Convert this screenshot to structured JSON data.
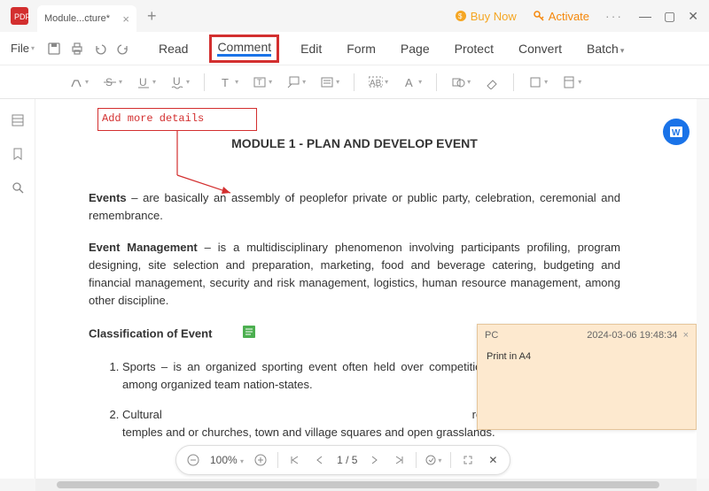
{
  "title": {
    "tab": "Module...cture*"
  },
  "titlebar": {
    "buynow": "Buy Now",
    "activate": "Activate"
  },
  "menu": {
    "file": "File",
    "tabs": [
      "Read",
      "Comment",
      "Edit",
      "Form",
      "Page",
      "Protect",
      "Convert",
      "Batch"
    ]
  },
  "annotation": {
    "text": "Add more details"
  },
  "doc": {
    "title": "MODULE 1 - PLAN AND DEVELOP EVENT",
    "p1a": "Events",
    "p1b": " – are basically an assembly of peoplefor private or public party, celebration, ceremonial and remembrance.",
    "p2a": "Event Management",
    "p2b": " – is a multidisciplinary phenomenon involving participants profiling, program designing, site selection and preparation, marketing, food and beverage catering, budgeting and financial management, security and risk management, logistics, human resource management, among other discipline.",
    "h2": "Classification of Event",
    "li1": "Sports – is an organized sporting event often held over competition in many different sports among organized team nation-states.",
    "li2_part": "Cultural",
    "li2_mid": "                                                                                             religion, local tradition",
    "li2_end": "e sites, temples and or churches, town and village squares and open grasslands."
  },
  "sticky": {
    "author": "PC",
    "time": "2024-03-06 19:48:34",
    "body": "Print in A4"
  },
  "pagectrl": {
    "zoom": "100%",
    "page": "1 / 5"
  }
}
